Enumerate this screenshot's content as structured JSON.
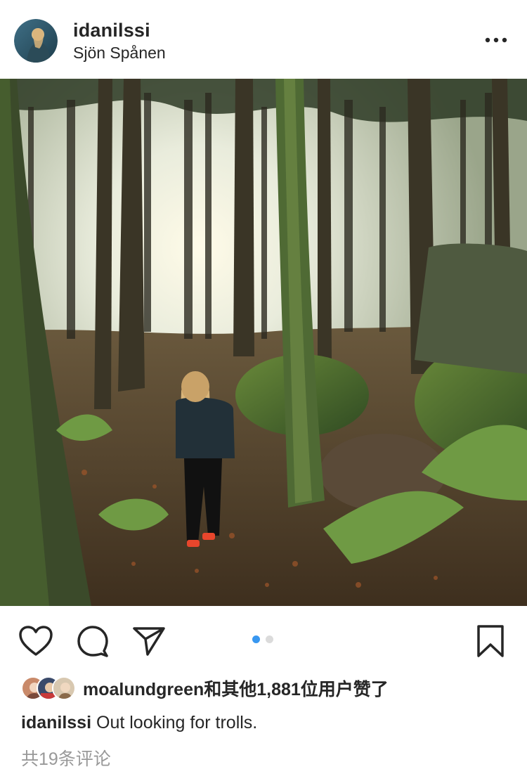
{
  "post": {
    "username": "idanilssi",
    "location": "Sjön Spånen",
    "more_icon": "more-horizontal-icon",
    "photo_alt": "",
    "carousel": {
      "total": 2,
      "active": 1
    },
    "likers_icons": [
      "avatar-1",
      "avatar-2",
      "avatar-3"
    ],
    "likes_text": "moalundgreen和其他1,881位用户赞了",
    "caption_user": "idanilssi",
    "caption_text": " Out looking for trolls.",
    "comments_text": "共19条评论"
  },
  "colors": {
    "text": "#262626",
    "muted": "#999999",
    "accent": "#3897f0"
  },
  "actions": [
    "heart-icon",
    "comment-icon",
    "share-icon",
    "bookmark-icon"
  ]
}
